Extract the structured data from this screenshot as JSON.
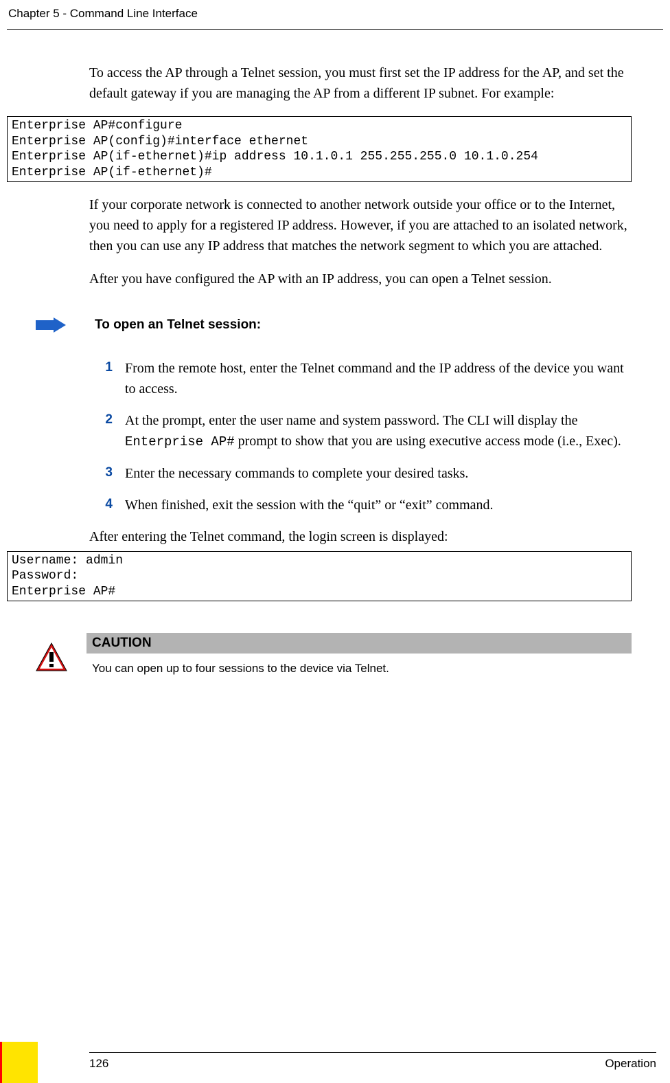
{
  "header": "Chapter 5 - Command Line Interface",
  "intro_para": "To access the AP through a Telnet session, you must first set the IP address for the AP, and set the default gateway if you are managing the AP from a different IP subnet. For example:",
  "code1": "Enterprise AP#configure\nEnterprise AP(config)#interface ethernet\nEnterprise AP(if-ethernet)#ip address 10.1.0.1 255.255.255.0 10.1.0.254\nEnterprise AP(if-ethernet)#",
  "para2": "If your corporate network is connected to another network outside your office or to the Internet, you need to apply for a registered IP address. However, if you are attached to an isolated network, then you can use any IP address that matches the network segment to which you are attached.",
  "para3": "After you have configured the AP with an IP address, you can open a Telnet session.",
  "procedure_title": "To open an Telnet session:",
  "steps": [
    {
      "num": "1",
      "text": "From the remote host, enter the Telnet command and the IP address of the device you want to access."
    },
    {
      "num": "2",
      "prefix": "At the prompt, enter the user name and system password. The CLI will display the ",
      "mono": "Enterprise AP#",
      "suffix": " prompt to show that you are using executive access mode (i.e., Exec)."
    },
    {
      "num": "3",
      "text": "Enter the necessary commands to complete your desired tasks."
    },
    {
      "num": "4",
      "text": "When finished, exit the session with the “quit” or “exit” command."
    }
  ],
  "para4": "After entering the Telnet command, the login screen is displayed:",
  "code2": "Username: admin\nPassword: \nEnterprise AP#",
  "caution": {
    "label": "CAUTION",
    "text": "You can open up to four sessions to the device via Telnet."
  },
  "footer": {
    "page": "126",
    "section": "Operation"
  }
}
